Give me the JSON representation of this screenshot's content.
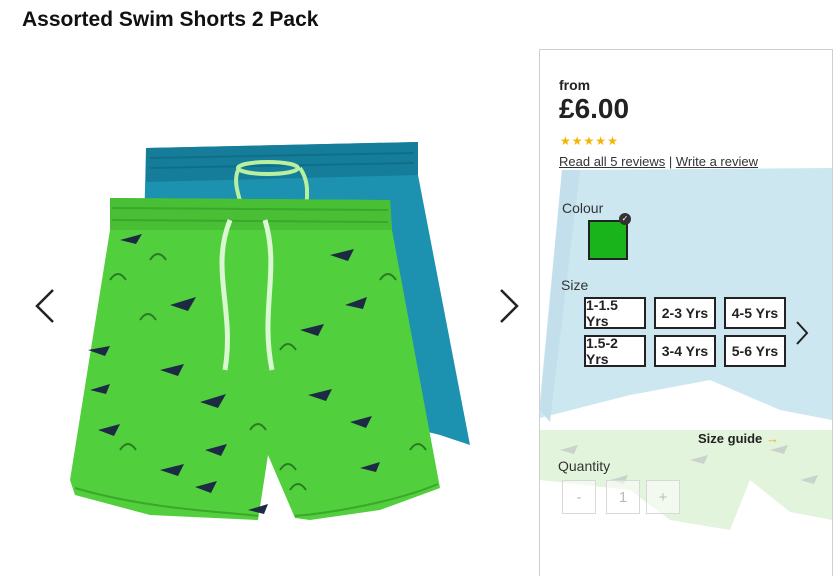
{
  "product": {
    "title": "Assorted Swim Shorts 2 Pack"
  },
  "pricing": {
    "from_label": "from",
    "price": "£6.00"
  },
  "rating": {
    "value": 5,
    "out_of": 5,
    "read_reviews": "Read all 5 reviews",
    "separator": "|",
    "write_review": "Write a review"
  },
  "colour": {
    "label": "Colour",
    "selected_hex": "#19b31b",
    "icon": "check-icon"
  },
  "size": {
    "label": "Size",
    "options": [
      "1-1.5 Yrs",
      "2-3 Yrs",
      "4-5 Yrs",
      "1.5-2 Yrs",
      "3-4 Yrs",
      "5-6 Yrs"
    ],
    "next_icon": "chevron-right-icon",
    "guide_label": "Size guide",
    "guide_arrow": "→"
  },
  "quantity": {
    "label": "Quantity",
    "minus": "-",
    "value": "1",
    "plus": "+"
  },
  "gallery": {
    "prev_icon": "chevron-left-icon",
    "next_icon": "chevron-right-icon"
  },
  "colors": {
    "star": "#f4b400",
    "accent": "#f6a623",
    "green_shorts": "#4fd13b",
    "blue_shorts": "#1a8fae"
  }
}
